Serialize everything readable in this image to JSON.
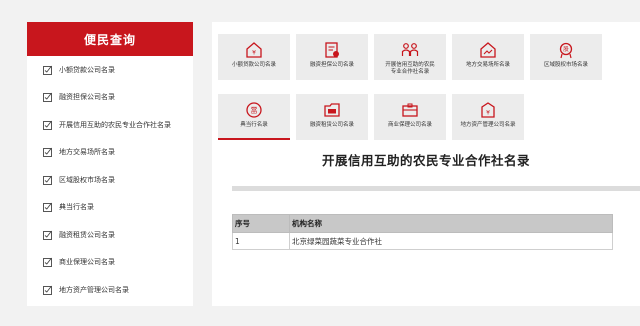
{
  "sidebar": {
    "title": "便民查询",
    "items": [
      {
        "label": "小额贷款公司名录"
      },
      {
        "label": "融资担保公司名录"
      },
      {
        "label": "开展信用互助的农民专业合作社名录"
      },
      {
        "label": "地方交易场所名录"
      },
      {
        "label": "区域股权市场名录"
      },
      {
        "label": "典当行名录"
      },
      {
        "label": "融资租赁公司名录"
      },
      {
        "label": "商业保理公司名录"
      },
      {
        "label": "地方资产管理公司名录"
      }
    ]
  },
  "tiles": [
    {
      "line1": "小额贷款公司名录",
      "line2": "",
      "icon": "house-coin-icon"
    },
    {
      "line1": "融资担保公司名录",
      "line2": "",
      "icon": "document-stamp-icon"
    },
    {
      "line1": "开展信用互助的农民",
      "line2": "专业合作社名录",
      "icon": "people-icon"
    },
    {
      "line1": "地方交易场所名录",
      "line2": "",
      "icon": "trading-house-icon"
    },
    {
      "line1": "区域股权市场名录",
      "line2": "",
      "icon": "equity-badge-icon"
    },
    {
      "line1": "典当行名录",
      "line2": "",
      "icon": "pawn-icon"
    },
    {
      "line1": "融资租赁公司名录",
      "line2": "",
      "icon": "lease-folder-icon"
    },
    {
      "line1": "商业保理公司名录",
      "line2": "",
      "icon": "factoring-box-icon"
    },
    {
      "line1": "地方资产管理公司名录",
      "line2": "",
      "icon": "asset-building-icon"
    }
  ],
  "main": {
    "title": "开展信用互助的农民专业合作社名录",
    "table": {
      "headers": [
        "序号",
        "机构名称"
      ],
      "rows": [
        [
          "1",
          "北京绿菜园蔬菜专业合作社"
        ]
      ]
    }
  },
  "colors": {
    "accent": "#c8161d"
  }
}
